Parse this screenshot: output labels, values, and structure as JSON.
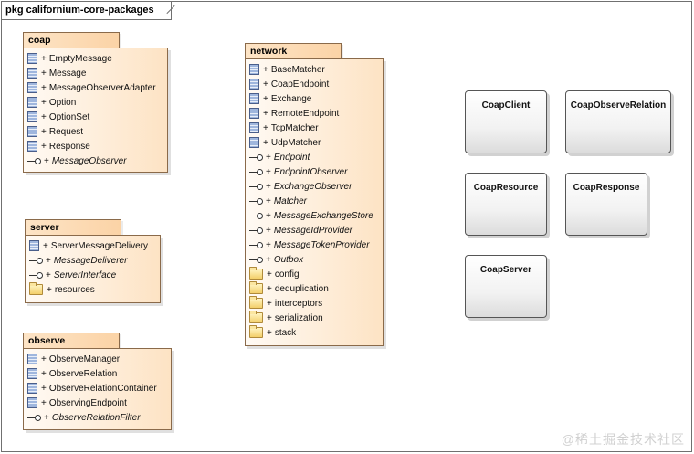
{
  "frame_title": "pkg californium-core-packages",
  "packages": {
    "coap": {
      "name": "coap",
      "items": [
        {
          "vis": "+",
          "name": "EmptyMessage",
          "kind": "class"
        },
        {
          "vis": "+",
          "name": "Message",
          "kind": "class"
        },
        {
          "vis": "+",
          "name": "MessageObserverAdapter",
          "kind": "class"
        },
        {
          "vis": "+",
          "name": "Option",
          "kind": "class"
        },
        {
          "vis": "+",
          "name": "OptionSet",
          "kind": "class"
        },
        {
          "vis": "+",
          "name": "Request",
          "kind": "class"
        },
        {
          "vis": "+",
          "name": "Response",
          "kind": "class"
        },
        {
          "vis": "+",
          "name": "MessageObserver",
          "kind": "interface"
        }
      ]
    },
    "server": {
      "name": "server",
      "items": [
        {
          "vis": "+",
          "name": "ServerMessageDelivery",
          "kind": "class"
        },
        {
          "vis": "+",
          "name": "MessageDeliverer",
          "kind": "interface"
        },
        {
          "vis": "+",
          "name": "ServerInterface",
          "kind": "interface"
        },
        {
          "vis": "+",
          "name": "resources",
          "kind": "package"
        }
      ]
    },
    "observe": {
      "name": "observe",
      "items": [
        {
          "vis": "+",
          "name": "ObserveManager",
          "kind": "class"
        },
        {
          "vis": "+",
          "name": "ObserveRelation",
          "kind": "class"
        },
        {
          "vis": "+",
          "name": "ObserveRelationContainer",
          "kind": "class"
        },
        {
          "vis": "+",
          "name": "ObservingEndpoint",
          "kind": "class"
        },
        {
          "vis": "+",
          "name": "ObserveRelationFilter",
          "kind": "interface"
        }
      ]
    },
    "network": {
      "name": "network",
      "items": [
        {
          "vis": "+",
          "name": "BaseMatcher",
          "kind": "class"
        },
        {
          "vis": "+",
          "name": "CoapEndpoint",
          "kind": "class"
        },
        {
          "vis": "+",
          "name": "Exchange",
          "kind": "class"
        },
        {
          "vis": "+",
          "name": "RemoteEndpoint",
          "kind": "class"
        },
        {
          "vis": "+",
          "name": "TcpMatcher",
          "kind": "class"
        },
        {
          "vis": "+",
          "name": "UdpMatcher",
          "kind": "class"
        },
        {
          "vis": "+",
          "name": "Endpoint",
          "kind": "interface"
        },
        {
          "vis": "+",
          "name": "EndpointObserver",
          "kind": "interface"
        },
        {
          "vis": "+",
          "name": "ExchangeObserver",
          "kind": "interface"
        },
        {
          "vis": "+",
          "name": "Matcher",
          "kind": "interface"
        },
        {
          "vis": "+",
          "name": "MessageExchangeStore",
          "kind": "interface"
        },
        {
          "vis": "+",
          "name": "MessageIdProvider",
          "kind": "interface"
        },
        {
          "vis": "+",
          "name": "MessageTokenProvider",
          "kind": "interface"
        },
        {
          "vis": "+",
          "name": "Outbox",
          "kind": "interface"
        },
        {
          "vis": "+",
          "name": "config",
          "kind": "package"
        },
        {
          "vis": "+",
          "name": "deduplication",
          "kind": "package"
        },
        {
          "vis": "+",
          "name": "interceptors",
          "kind": "package"
        },
        {
          "vis": "+",
          "name": "serialization",
          "kind": "package"
        },
        {
          "vis": "+",
          "name": "stack",
          "kind": "package"
        }
      ]
    }
  },
  "classes": {
    "coap_client": "CoapClient",
    "coap_observe_relation": "CoapObserveRelation",
    "coap_resource": "CoapResource",
    "coap_response": "CoapResponse",
    "coap_server": "CoapServer"
  },
  "watermark": "@稀土掘金技术社区"
}
